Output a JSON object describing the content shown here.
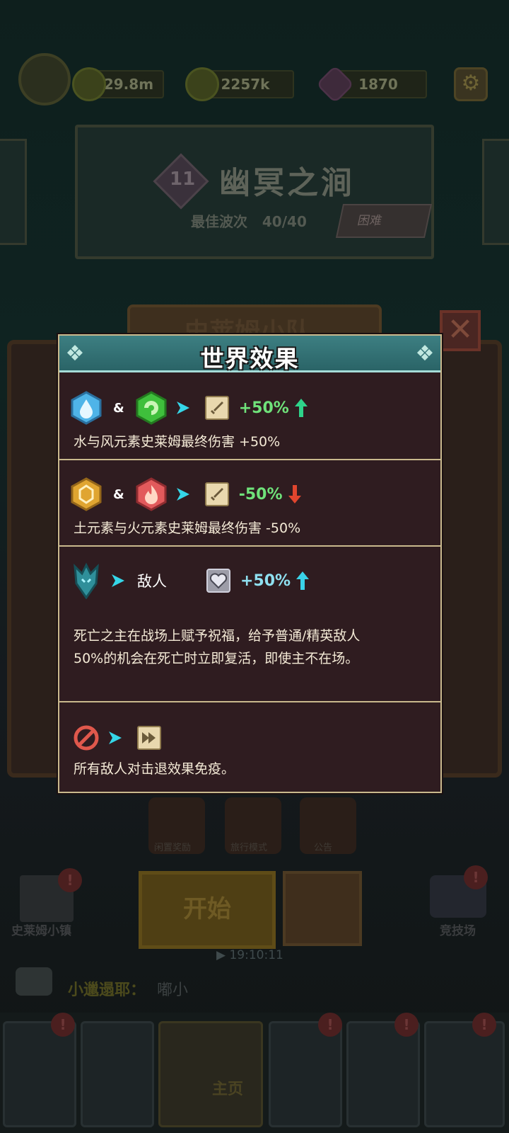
{
  "background": {
    "stats": {
      "power": "129.8m",
      "coins": "2257k",
      "gems": "1870"
    },
    "stage": {
      "number": "11",
      "title": "幽冥之涧",
      "best_wave_label": "最佳波次",
      "best_wave_value": "40/40",
      "difficulty": "困难"
    },
    "board": {
      "title": "史莱姆小队",
      "start_label": "开始"
    },
    "shortcuts": [
      {
        "label": "闲置奖励"
      },
      {
        "label": "旅行模式"
      },
      {
        "label": "公告"
      }
    ],
    "town_label": "史莱姆小镇",
    "main_start_label": "开始",
    "timer": "19:10:11",
    "arena_label": "竞技场",
    "chat": {
      "name": "小邋遢耶：",
      "message": "嘟小"
    },
    "nav": {
      "home_label": "主页"
    }
  },
  "popup": {
    "title": "世界效果",
    "effects": [
      {
        "amp": "&",
        "value": "+50%",
        "direction": "up",
        "description": "水与风元素史莱姆最终伤害 +50%"
      },
      {
        "amp": "&",
        "value": "-50%",
        "direction": "down",
        "description": "土元素与火元素史莱姆最终伤害 -50%"
      },
      {
        "target": "敌人",
        "value": "+50%",
        "direction": "up",
        "description_line1": "死亡之主在战场上赋予祝福，给予普通/精英敌人",
        "description_line2": "50%的机会在死亡时立即复活，即使主不在场。"
      },
      {
        "description": "所有敌人对击退效果免疫。"
      }
    ]
  },
  "colors": {
    "header_teal": "#3d7f82",
    "panel_bg": "#2f1c20",
    "border_gold": "#c9b98d",
    "positive_green": "#6fe27a",
    "arrow_cyan": "#35d6e8",
    "arrow_red": "#e0452e"
  },
  "icons": {
    "water": "water-element-icon",
    "wind": "wind-element-icon",
    "earth": "earth-element-icon",
    "fire": "fire-element-icon",
    "sword": "sword-icon",
    "death_lord": "death-lord-icon",
    "revive": "revive-heart-icon",
    "forbidden": "forbidden-icon",
    "knockback": "knockback-icon"
  }
}
